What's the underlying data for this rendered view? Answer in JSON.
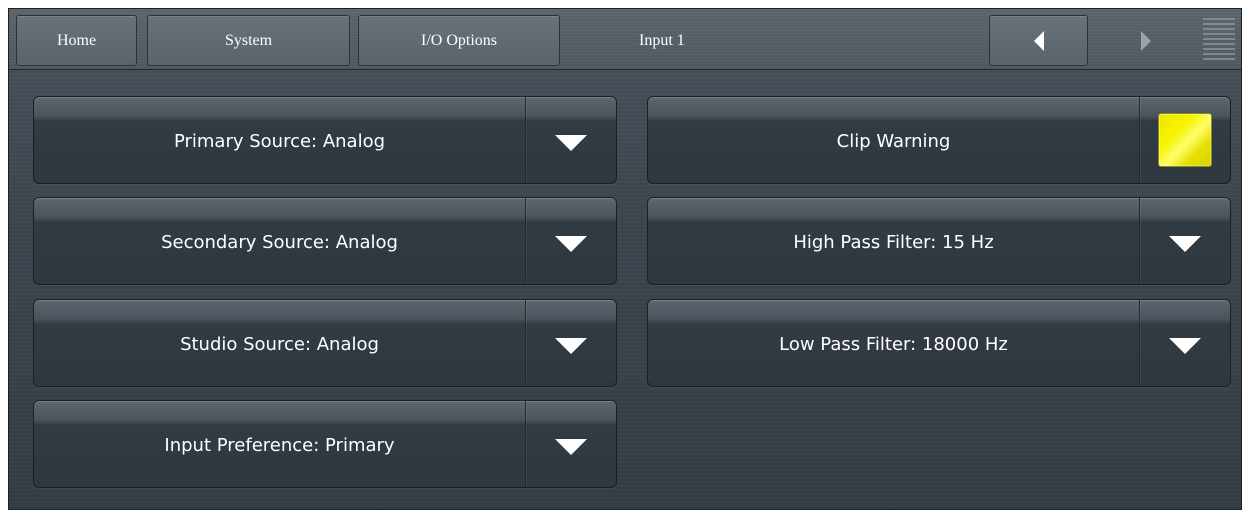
{
  "topbar": {
    "tabs": [
      "Home",
      "System",
      "I/O Options"
    ],
    "breadcrumb": "Input 1"
  },
  "panels_left": [
    {
      "label": "Primary Source: Analog"
    },
    {
      "label": "Secondary Source: Analog"
    },
    {
      "label": "Studio Source: Analog"
    },
    {
      "label": "Input Preference: Primary"
    }
  ],
  "panels_right": [
    {
      "label": "Clip Warning",
      "indicator_color": "#f2ef00"
    },
    {
      "label": "High Pass Filter: 15 Hz"
    },
    {
      "label": "Low Pass Filter: 18000 Hz"
    }
  ],
  "icons": {
    "back": "chevron-left-icon",
    "forward": "chevron-right-icon",
    "menu": "menu-icon",
    "dropdown": "dropdown-triangle-icon"
  }
}
